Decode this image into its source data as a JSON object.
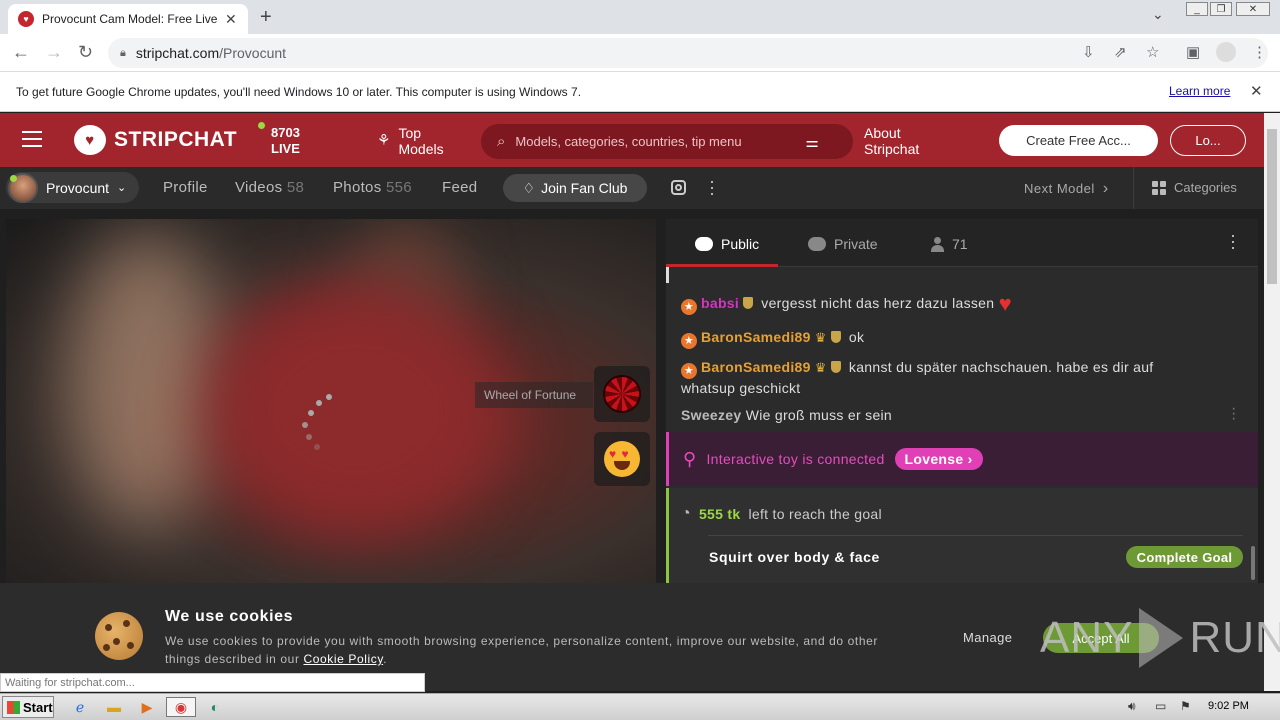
{
  "browser": {
    "tab_title": "Provocunt Cam Model: Free Live Se",
    "tab_close": "✕",
    "new_tab": "+",
    "url_domain": "stripchat.com",
    "url_path": "/Provocunt",
    "infobar_text": "To get future Google Chrome updates, you'll need Windows 10 or later. This computer is using Windows 7.",
    "learn_more": "Learn more",
    "status_text": "Waiting for stripchat.com..."
  },
  "header": {
    "logo_text": "STRIPCHAT",
    "live_count": "8703",
    "live_label": "LIVE",
    "top_models": "Top Models",
    "search_placeholder": "Models, categories, countries, tip menu",
    "about": "About Stripchat",
    "create_account": "Create Free Acc...",
    "login": "Lo..."
  },
  "model_bar": {
    "model_name": "Provocunt",
    "tabs": [
      {
        "label": "Profile",
        "count": ""
      },
      {
        "label": "Videos",
        "count": "58"
      },
      {
        "label": "Photos",
        "count": "556"
      },
      {
        "label": "Feed",
        "count": ""
      }
    ],
    "fan_club": "Join Fan Club",
    "next_model": "Next Model",
    "categories": "Categories"
  },
  "video": {
    "wheel_label": "Wheel of Fortune"
  },
  "chat": {
    "tabs": {
      "public": "Public",
      "private": "Private",
      "users": "71"
    },
    "messages": [
      {
        "user": "babsi",
        "text": "vergesst nicht das herz dazu lassen"
      },
      {
        "user": "BaronSamedi89",
        "text": "ok"
      },
      {
        "user": "BaronSamedi89",
        "text": "kannst du später nachschauen. habe es dir auf whatsup geschickt"
      },
      {
        "user": "Sweezey",
        "text": "Wie groß muss er sein"
      }
    ],
    "toy_text": "Interactive toy is connected",
    "toy_brand": "Lovense",
    "goal_tokens": "555 tk",
    "goal_text": "left to reach the goal",
    "goal_name": "Squirt over body & face",
    "complete_goal": "Complete Goal"
  },
  "cookie": {
    "title": "We use cookies",
    "text": "We use cookies to provide you with smooth browsing experience, personalize content, improve our website, and do other things described in our",
    "policy_link": "Cookie Policy",
    "manage": "Manage",
    "accept": "Accept All"
  },
  "watermark": {
    "text": "RUN",
    "prefix": "ANY"
  },
  "taskbar": {
    "start": "Start",
    "clock": "9:02 PM"
  }
}
